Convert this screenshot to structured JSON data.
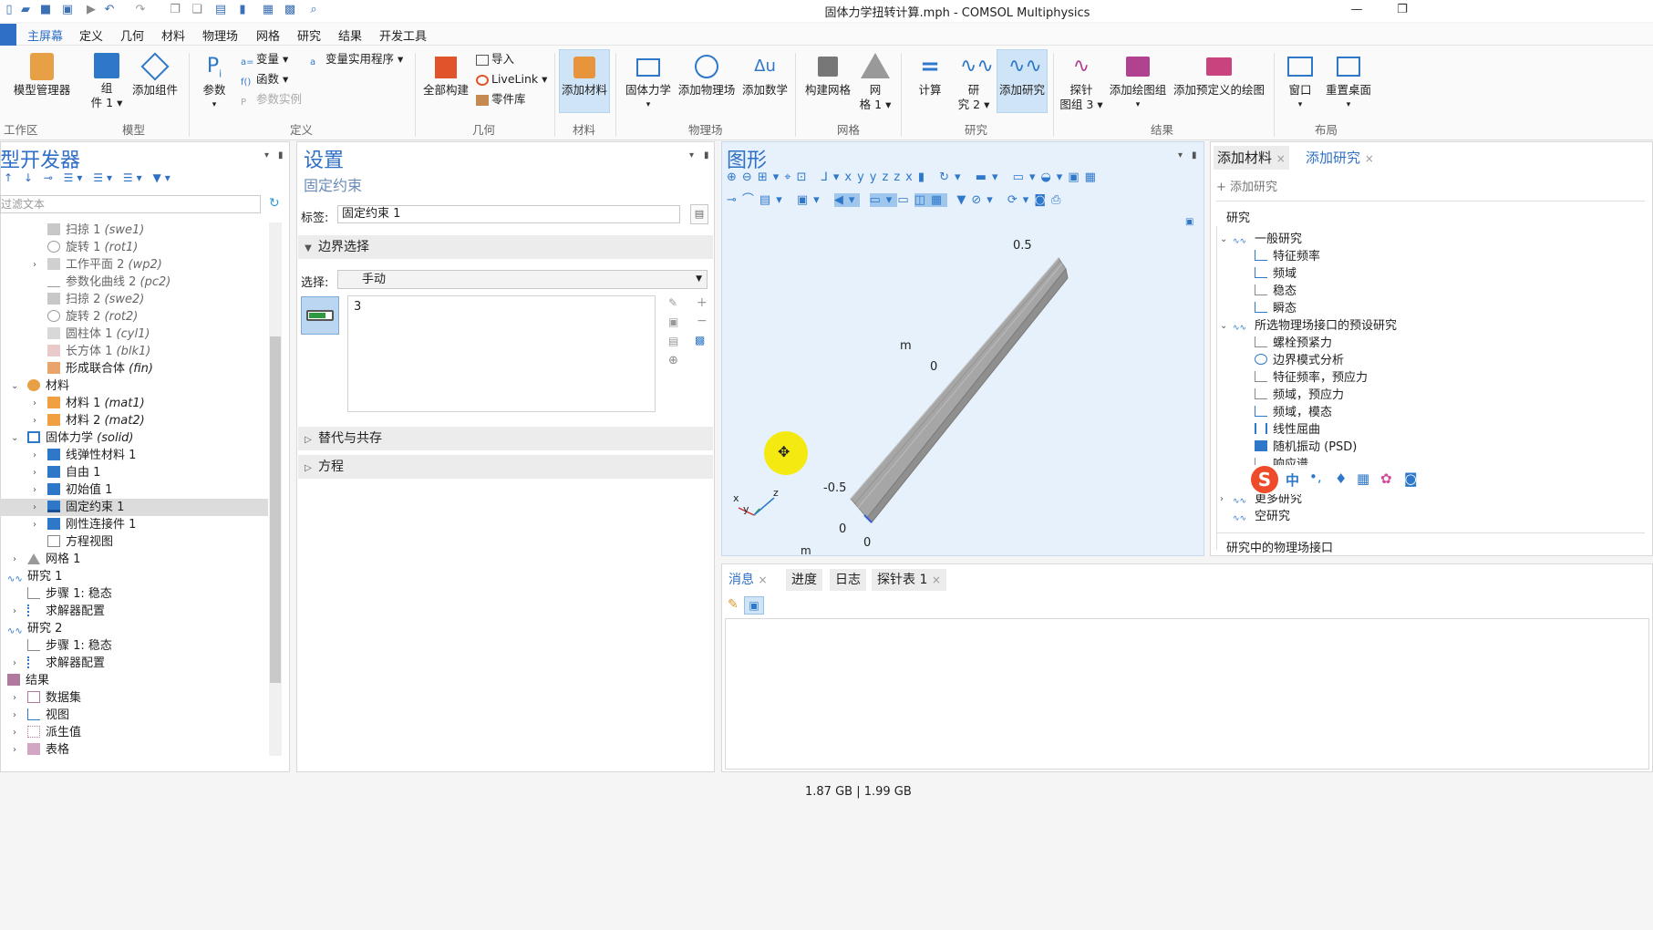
{
  "window": {
    "title": "固体力学扭转计算.mph - COMSOL Multiphysics"
  },
  "menu": [
    "主屏幕",
    "定义",
    "几何",
    "材料",
    "物理场",
    "网格",
    "研究",
    "结果",
    "开发工具"
  ],
  "ribbon": {
    "model_manager": "模型管理器",
    "component_1": "组件 1",
    "component_1_l1": "组",
    "component_1_l2": "件 1",
    "add_component": "添加组件",
    "parameters": "参数",
    "variables": "变量",
    "functions": "函数",
    "param_case": "参数实例",
    "var_utils": "变量实用程序",
    "build_all": "全部构建",
    "import": "导入",
    "livelink": "LiveLink",
    "parts_lib": "零件库",
    "add_material": "添加材料",
    "solid_mech": "固体力学",
    "add_physics": "添加物理场",
    "add_math": "添加数学",
    "build_mesh": "构建网格",
    "mesh1_l1": "网",
    "mesh1_l2": "格 1",
    "compute": "计算",
    "study2_l1": "研",
    "study2_l2": "究 2",
    "add_study": "添加研究",
    "probe_l1": "探针",
    "probe_l2": "图组 3",
    "add_plot": "添加绘图组",
    "add_predef_plot": "添加预定义的绘图",
    "windows": "窗口",
    "reset_desktop": "重置桌面",
    "groups": {
      "workspace": "工作区",
      "model": "模型",
      "definitions": "定义",
      "geometry": "几何",
      "materials": "材料",
      "physics": "物理场",
      "mesh": "网格",
      "study": "研究",
      "results": "结果",
      "layout": "布局"
    }
  },
  "model_builder": {
    "title": "型开发器",
    "filter_placeholder": "过滤文本",
    "nodes": [
      {
        "label": "扫掠 1",
        "tag": "(swe1)"
      },
      {
        "label": "旋转 1",
        "tag": "(rot1)"
      },
      {
        "label": "工作平面 2",
        "tag": "(wp2)"
      },
      {
        "label": "参数化曲线 2",
        "tag": "(pc2)"
      },
      {
        "label": "扫掠 2",
        "tag": "(swe2)"
      },
      {
        "label": "旋转 2",
        "tag": "(rot2)"
      },
      {
        "label": "圆柱体 1",
        "tag": "(cyl1)"
      },
      {
        "label": "长方体 1",
        "tag": "(blk1)"
      },
      {
        "label": "形成联合体",
        "tag": "(fin)"
      },
      {
        "label": "材料",
        "tag": ""
      },
      {
        "label": "材料 1",
        "tag": "(mat1)"
      },
      {
        "label": "材料 2",
        "tag": "(mat2)"
      },
      {
        "label": "固体力学",
        "tag": "(solid)"
      },
      {
        "label": "线弹性材料 1",
        "tag": ""
      },
      {
        "label": "自由 1",
        "tag": ""
      },
      {
        "label": "初始值 1",
        "tag": ""
      },
      {
        "label": "固定约束 1",
        "tag": ""
      },
      {
        "label": "刚性连接件 1",
        "tag": ""
      },
      {
        "label": "方程视图",
        "tag": ""
      },
      {
        "label": "网格 1",
        "tag": ""
      },
      {
        "label": "研究 1",
        "tag": ""
      },
      {
        "label": "步骤 1: 稳态",
        "tag": ""
      },
      {
        "label": "求解器配置",
        "tag": ""
      },
      {
        "label": "研究 2",
        "tag": ""
      },
      {
        "label": "步骤 1: 稳态",
        "tag": ""
      },
      {
        "label": "求解器配置",
        "tag": ""
      },
      {
        "label": "结果",
        "tag": ""
      },
      {
        "label": "数据集",
        "tag": ""
      },
      {
        "label": "视图",
        "tag": ""
      },
      {
        "label": "派生值",
        "tag": ""
      },
      {
        "label": "表格",
        "tag": ""
      }
    ]
  },
  "settings": {
    "title": "设置",
    "subtitle": "固定约束",
    "label_caption": "标签:",
    "label_value": "固定约束 1",
    "section_boundary": "边界选择",
    "selection_caption": "选择:",
    "selection_value": "手动",
    "list_item": "3",
    "section_override": "替代与共存",
    "section_equation": "方程"
  },
  "graphics": {
    "title": "图形",
    "labels": {
      "top": "0.5",
      "m1": "m",
      "zero1": "0",
      "neg": "-0.5",
      "zero2": "0",
      "zero3": "0",
      "m2": "m",
      "ax_x": "x",
      "ax_y": "y",
      "ax_z": "z"
    }
  },
  "right_panel": {
    "tab_add_material": "添加材料",
    "tab_add_study": "添加研究",
    "add_study_btn": "添加研究",
    "studies_header": "研究",
    "general_studies": "一般研究",
    "general_items": [
      "特征频率",
      "频域",
      "稳态",
      "瞬态"
    ],
    "preset_group": "所选物理场接口的预设研究",
    "preset_items": [
      "螺栓预紧力",
      "边界模式分析",
      "特征频率，预应力",
      "频域，预应力",
      "频域，模态",
      "线性屈曲",
      "随机振动 (PSD)",
      "响应谱"
    ],
    "more_studies": "更多研究",
    "empty_study": "空研究",
    "physics_in_study": "研究中的物理场接口"
  },
  "bottom": {
    "tabs": [
      "消息",
      "进度",
      "日志",
      "探针表 1"
    ]
  },
  "ime": {
    "chinese": "中",
    "punct": "•,"
  },
  "status": {
    "memory": "1.87 GB | 1.99 GB"
  },
  "colors": {
    "accent": "#2f6fc5",
    "selection_bg": "#cfe4f7"
  }
}
